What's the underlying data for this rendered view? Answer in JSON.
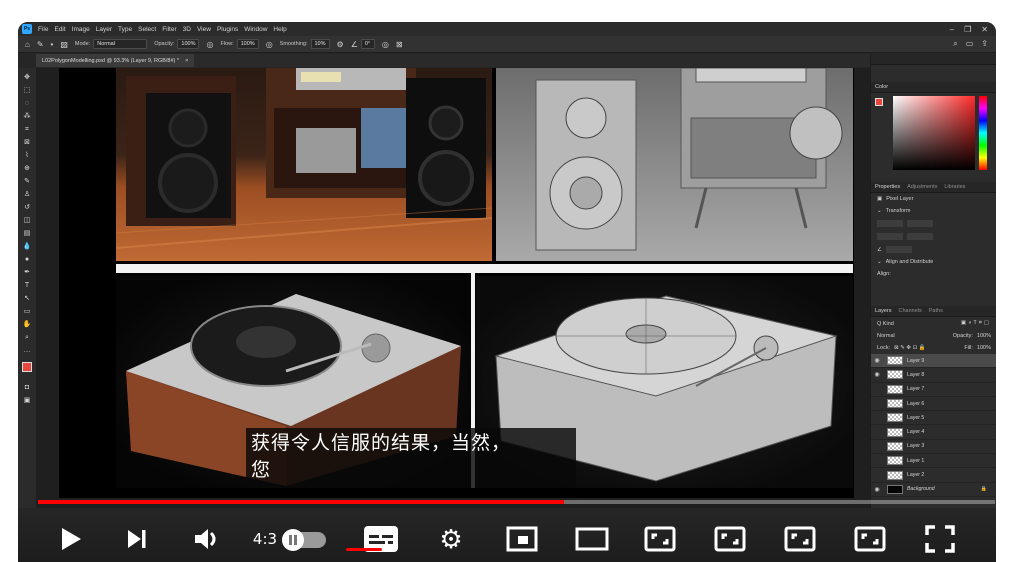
{
  "menubar": {
    "logo": "Ps",
    "items": [
      "File",
      "Edit",
      "Image",
      "Layer",
      "Type",
      "Select",
      "Filter",
      "3D",
      "View",
      "Plugins",
      "Window",
      "Help"
    ]
  },
  "options": {
    "mode_label": "Mode:",
    "mode_value": "Normal",
    "opacity_label": "Opacity:",
    "opacity_value": "100%",
    "flow_label": "Flow:",
    "flow_value": "100%",
    "smoothing_label": "Smoothing:",
    "smoothing_value": "10%",
    "angle_value": "0°"
  },
  "document_tab": {
    "title": "L02PolygonModelling.psd @ 93.3% (Layer 9, RGB/8#) *",
    "close": "×"
  },
  "color_panel": {
    "title": "Color"
  },
  "properties_panel": {
    "tabs": [
      "Properties",
      "Adjustments",
      "Libraries"
    ],
    "pixel_layer": "Pixel Layer",
    "transform": "Transform",
    "align": "Align and Distribute",
    "align_sub": "Align:"
  },
  "layers_panel": {
    "tabs": [
      "Layers",
      "Channels",
      "Paths"
    ],
    "kind": "Q Kind",
    "blend": "Normal",
    "opacity_label": "Opacity:",
    "opacity_value": "100%",
    "lock_label": "Lock:",
    "fill_label": "Fill:",
    "fill_value": "100%",
    "layers": [
      {
        "name": "Layer 9",
        "visible": true,
        "selected": true
      },
      {
        "name": "Layer 8",
        "visible": true,
        "selected": false
      },
      {
        "name": "Layer 7",
        "visible": false,
        "selected": false
      },
      {
        "name": "Layer 6",
        "visible": false,
        "selected": false
      },
      {
        "name": "Layer 5",
        "visible": false,
        "selected": false
      },
      {
        "name": "Layer 4",
        "visible": false,
        "selected": false
      },
      {
        "name": "Layer 3",
        "visible": false,
        "selected": false
      },
      {
        "name": "Layer 1",
        "visible": false,
        "selected": false
      },
      {
        "name": "Layer 2",
        "visible": false,
        "selected": false
      },
      {
        "name": "Background",
        "visible": true,
        "selected": false
      }
    ]
  },
  "subtitle": {
    "line1": "获得令人信服的结果，当然，",
    "line2": "您"
  },
  "player": {
    "progress": 0.55,
    "speed_label": "4:3",
    "accent_color": "#ff0000"
  }
}
